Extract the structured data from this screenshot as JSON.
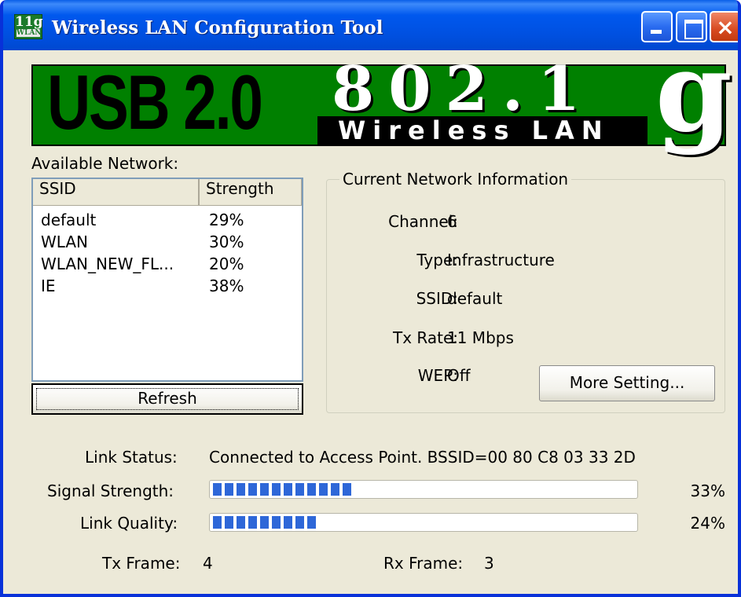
{
  "window": {
    "title": "Wireless LAN Configuration Tool",
    "icon_top": "11g",
    "icon_bottom": "WLAN",
    "close_glyph": "×"
  },
  "banner": {
    "usb": "USB 2.0",
    "num": "802.1",
    "g": "g",
    "wireless": "Wireless LAN"
  },
  "networks": {
    "label": "Available Network:",
    "columns": [
      "SSID",
      "Strength"
    ],
    "rows": [
      {
        "ssid": "default",
        "strength": "29%"
      },
      {
        "ssid": "WLAN",
        "strength": "30%"
      },
      {
        "ssid": "WLAN_NEW_FL...",
        "strength": "20%"
      },
      {
        "ssid": "IE",
        "strength": "38%"
      }
    ],
    "refresh_label": "Refresh"
  },
  "current": {
    "group_title": "Current Network Information",
    "channel_label": "Channel:",
    "channel": "6",
    "type_label": "Type:",
    "type": "Infrastructure",
    "ssid_label": "SSID:",
    "ssid": "default",
    "txrate_label": "Tx Rate:",
    "txrate": "11 Mbps",
    "wep_label": "WEP:",
    "wep": "Off",
    "more_label": "More Setting..."
  },
  "status": {
    "link_label": "Link Status:",
    "link": "Connected to Access Point. BSSID=00 80 C8 03 33 2D",
    "signal_label": "Signal Strength:",
    "signal_pct": "33%",
    "signal_value": 0.33,
    "quality_label": "Link Quality:",
    "quality_pct": "24%",
    "quality_value": 0.24,
    "tx_label": "Tx Frame:",
    "tx": "4",
    "rx_label": "Rx Frame:",
    "rx": "3"
  },
  "colors": {
    "titlebar": "#0058ee",
    "banner_green": "#008000",
    "progress_blue": "#2e67d8",
    "window_bg": "#ece9d8"
  }
}
